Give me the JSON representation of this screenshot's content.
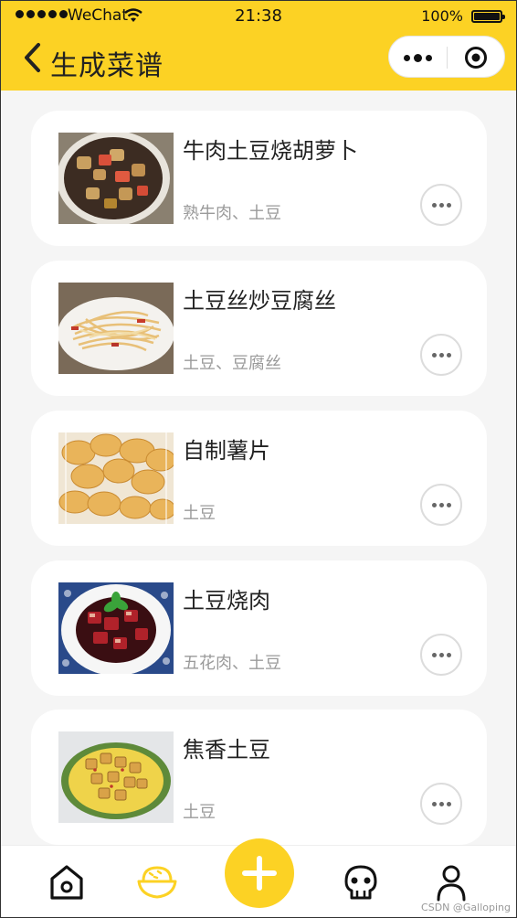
{
  "status_bar": {
    "carrier": "WeChat",
    "time": "21:38",
    "battery": "100%"
  },
  "nav": {
    "title": "生成菜谱"
  },
  "recipes": [
    {
      "name": "牛肉土豆烧胡萝卜",
      "ingredients": "熟牛肉、土豆"
    },
    {
      "name": "土豆丝炒豆腐丝",
      "ingredients": "土豆、豆腐丝"
    },
    {
      "name": "自制薯片",
      "ingredients": "土豆"
    },
    {
      "name": "土豆烧肉",
      "ingredients": "五花肉、土豆"
    },
    {
      "name": "焦香土豆",
      "ingredients": "土豆"
    }
  ],
  "tabbar": {
    "tabs": [
      "home-icon",
      "rice-bowl-icon",
      "plus-icon",
      "robot-icon",
      "user-icon"
    ],
    "active_color": "#fcd224"
  },
  "watermark": "CSDN @Galloping",
  "colors": {
    "brand": "#fcd224",
    "background": "#f5f5f5"
  }
}
